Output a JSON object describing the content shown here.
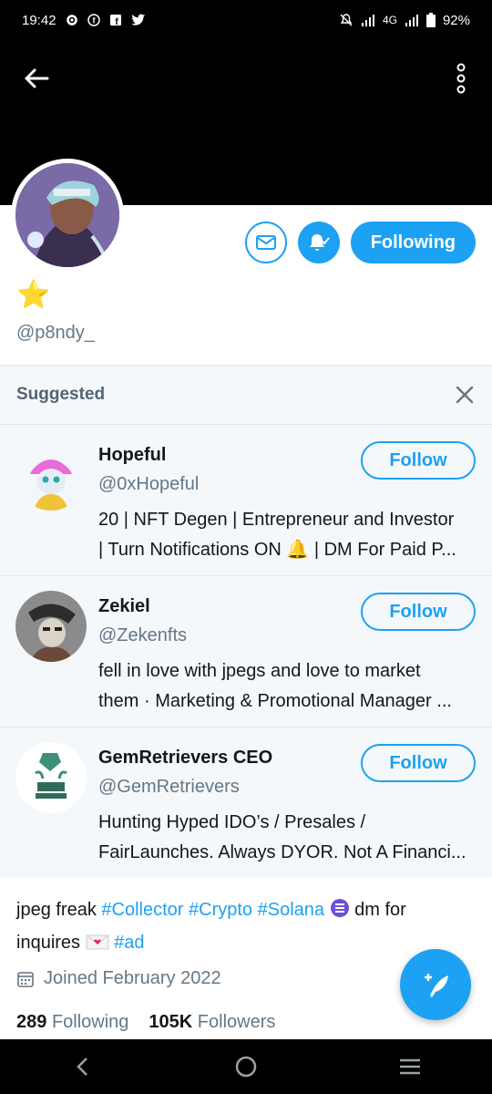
{
  "status_bar": {
    "time": "19:42",
    "network": "4G",
    "battery": "92%"
  },
  "header": {
    "back_icon": "arrow-left-icon",
    "more_icon": "more-vertical-icon"
  },
  "profile": {
    "emoji_name": "star",
    "emoji": "⭐",
    "handle": "@p8ndy_",
    "following_label": "Following",
    "bio_text": "jpeg freak",
    "bio_tags": [
      "#Collector",
      "#Crypto",
      "#Solana"
    ],
    "bio_text2": "dm for inquires",
    "bio_tag_ad": "#ad",
    "joined": "Joined February 2022",
    "following_count": "289",
    "following_text": "Following",
    "followers_count": "105K",
    "followers_text": "Followers"
  },
  "suggested": {
    "title": "Suggested",
    "items": [
      {
        "name": "Hopeful",
        "handle": "@0xHopeful",
        "bio_line1": "20 | NFT Degen | Entrepreneur and Investor",
        "bio_line2": "| Turn Notifications ON 🔔 | DM For Paid P...",
        "follow_label": "Follow"
      },
      {
        "name": "Zekiel",
        "handle": "@Zekenfts",
        "bio_line1": "fell in love with jpegs and love to market",
        "bio_line2": "them · Marketing & Promotional Manager ...",
        "follow_label": "Follow"
      },
      {
        "name": "GemRetrievers CEO",
        "handle": "@GemRetrievers",
        "bio_line1": "Hunting Hyped IDO’s / Presales /",
        "bio_line2": "FairLaunches. Always DYOR. Not A Financi...",
        "follow_label": "Follow"
      }
    ]
  },
  "colors": {
    "accent": "#1da1f2",
    "muted": "#657786"
  }
}
